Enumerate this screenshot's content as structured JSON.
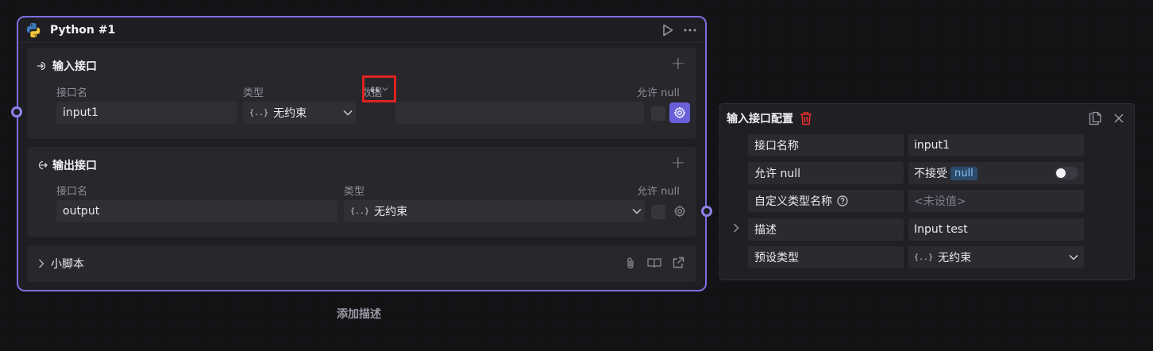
{
  "node": {
    "title": "Python #1",
    "input_section": {
      "title": "输入接口",
      "col_name": "接口名",
      "col_type": "类型",
      "col_data": "数据",
      "col_null": "允许 null",
      "row": {
        "name": "input1",
        "type": "无约束",
        "data_icon": "quote-icon"
      }
    },
    "output_section": {
      "title": "输出接口",
      "col_name": "接口名",
      "col_type": "类型",
      "col_null": "允许 null",
      "row": {
        "name": "output",
        "type": "无约束"
      }
    },
    "script_section": {
      "title": "小脚本"
    },
    "add_description": "添加描述"
  },
  "panel": {
    "title": "输入接口配置",
    "rows": [
      {
        "label": "接口名称",
        "value": "input1"
      },
      {
        "label": "允许 null",
        "value": "不接受",
        "badge": "null",
        "toggle_on": false
      },
      {
        "label": "自定义类型名称",
        "value": "<未设值>"
      },
      {
        "label": "描述",
        "value": "Input test"
      },
      {
        "label": "预设类型",
        "value": "无约束"
      }
    ]
  },
  "colors": {
    "accent": "#7c6fe0",
    "danger": "#e5322d",
    "highlight_box": "#e0221f"
  }
}
